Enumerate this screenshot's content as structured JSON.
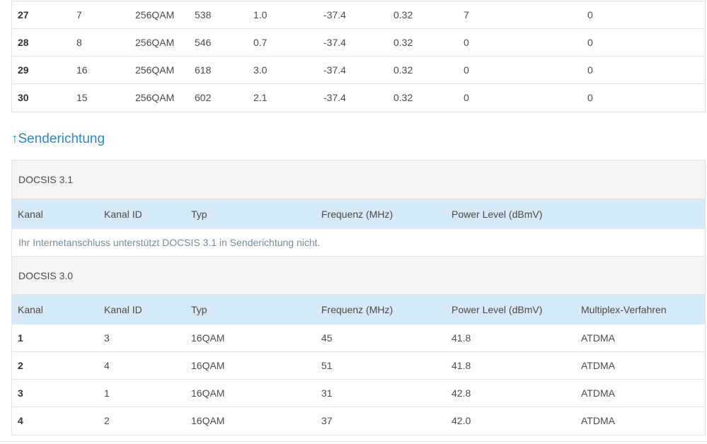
{
  "downstream_rows": [
    [
      "27",
      "7",
      "256QAM",
      "538",
      "1.0",
      "-37.4",
      "0.32",
      "7",
      "0"
    ],
    [
      "28",
      "8",
      "256QAM",
      "546",
      "0.7",
      "-37.4",
      "0.32",
      "0",
      "0"
    ],
    [
      "29",
      "16",
      "256QAM",
      "618",
      "3.0",
      "-37.4",
      "0.32",
      "0",
      "0"
    ],
    [
      "30",
      "15",
      "256QAM",
      "602",
      "2.1",
      "-37.4",
      "0.32",
      "0",
      "0"
    ]
  ],
  "upstream": {
    "arrow": "↑",
    "title": "Senderichtung",
    "docsis31": {
      "label": "DOCSIS 3.1",
      "headers": [
        "Kanal",
        "Kanal ID",
        "Typ",
        "Frequenz (MHz)",
        "Power Level (dBmV)"
      ],
      "notice": "Ihr Internetanschluss unterstützt DOCSIS 3.1 in Senderichtung nicht."
    },
    "docsis30": {
      "label": "DOCSIS 3.0",
      "headers": [
        "Kanal",
        "Kanal ID",
        "Typ",
        "Frequenz (MHz)",
        "Power Level (dBmV)",
        "Multiplex-Verfahren"
      ],
      "rows": [
        [
          "1",
          "3",
          "16QAM",
          "45",
          "41.8",
          "ATDMA"
        ],
        [
          "2",
          "4",
          "16QAM",
          "51",
          "41.8",
          "ATDMA"
        ],
        [
          "3",
          "1",
          "16QAM",
          "31",
          "42.8",
          "ATDMA"
        ],
        [
          "4",
          "2",
          "16QAM",
          "37",
          "42.0",
          "ATDMA"
        ]
      ]
    }
  }
}
